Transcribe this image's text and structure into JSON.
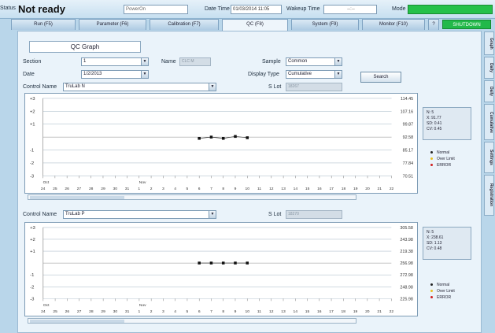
{
  "status": {
    "label": "Status",
    "value": "Not ready",
    "power_field": "PowerOn",
    "datetime_label": "Date Time",
    "datetime_value": "01/03/2014 11:05",
    "wakeup_label": "Wakeup Time",
    "wakeup_value": "--:--",
    "mode_label": "Mode"
  },
  "tabs": [
    {
      "label": "Run (F5)"
    },
    {
      "label": "Parameter (F6)"
    },
    {
      "label": "Calibration (F7)"
    },
    {
      "label": "QC (F8)"
    },
    {
      "label": "System (F9)"
    },
    {
      "label": "Monitor (F10)"
    },
    {
      "label": "?"
    },
    {
      "label": "SHUTDOWN"
    }
  ],
  "side_tabs": [
    "Graph",
    "Daily",
    "Daily",
    "Cumulative",
    "Settings",
    "Registration"
  ],
  "panel": {
    "title": "QC Graph",
    "section_label": "Section",
    "section_value": "1",
    "name_label": "Name",
    "name_value": "CLC M",
    "sample_label": "Sample",
    "sample_value": "Common",
    "date_label": "Date",
    "date_value": "1/2/2013",
    "display_type_label": "Display Type",
    "display_type_value": "Cumulative",
    "search_button": "Search",
    "lot1": {
      "control_label": "Control Name",
      "control_value": "TruLab N",
      "lot_label": "S Lot",
      "lot_value": "18267"
    },
    "lot2": {
      "control_label": "Control Name",
      "control_value": "TruLab P",
      "lot_label": "S Lot",
      "lot_value": "18270"
    }
  },
  "chart_data": [
    {
      "type": "scatter",
      "y_categories": [
        "+3",
        "+2",
        "+1",
        "",
        "-1",
        "-2",
        "-3"
      ],
      "right_ticks": [
        "114.45",
        "107.16",
        "99.87",
        "92.58",
        "85.17",
        "77.84",
        "70.51"
      ],
      "x": [
        6,
        7,
        8,
        9,
        10
      ],
      "y": [
        -0.1,
        0.0,
        -0.1,
        0.05,
        -0.05
      ],
      "x_ticks": [
        "24",
        "25",
        "26",
        "27",
        "28",
        "29",
        "30",
        "31",
        "1",
        "2",
        "3",
        "4",
        "5",
        "6",
        "7",
        "8",
        "9",
        "10",
        "11",
        "12",
        "13",
        "14",
        "15",
        "16",
        "17",
        "18",
        "19",
        "20",
        "21",
        "22"
      ],
      "month_labels": [
        "Oct",
        "Nov"
      ],
      "stats": [
        "N:    5",
        "X:    91.77",
        "SD:   0.41",
        "CV:   0.45"
      ],
      "legend": [
        {
          "label": "Normal",
          "color": "#222222"
        },
        {
          "label": "Over Limit",
          "color": "#e8c020"
        },
        {
          "label": "ERROR",
          "color": "#d02020"
        }
      ]
    },
    {
      "type": "scatter",
      "y_categories": [
        "+3",
        "+2",
        "+1",
        "",
        "-1",
        "-2",
        "-3"
      ],
      "right_ticks": [
        "305.58",
        "243.98",
        "219.38",
        "256.98",
        "272.98",
        "248.98",
        "225.98"
      ],
      "x": [
        6,
        7,
        8,
        9,
        10
      ],
      "y": [
        0.0,
        0.0,
        0.0,
        0.0,
        0.0
      ],
      "x_ticks": [
        "24",
        "25",
        "26",
        "27",
        "28",
        "29",
        "30",
        "31",
        "1",
        "2",
        "3",
        "4",
        "5",
        "6",
        "7",
        "8",
        "9",
        "10",
        "11",
        "12",
        "13",
        "14",
        "15",
        "16",
        "17",
        "18",
        "19",
        "20",
        "21",
        "22"
      ],
      "month_labels": [
        "Oct",
        "Nov"
      ],
      "stats": [
        "N:    5",
        "X:    238.61",
        "SD:   1.13",
        "CV:   0.48"
      ],
      "legend": [
        {
          "label": "Normal",
          "color": "#222222"
        },
        {
          "label": "Over Limit",
          "color": "#e8c020"
        },
        {
          "label": "ERROR",
          "color": "#d02020"
        }
      ]
    }
  ]
}
